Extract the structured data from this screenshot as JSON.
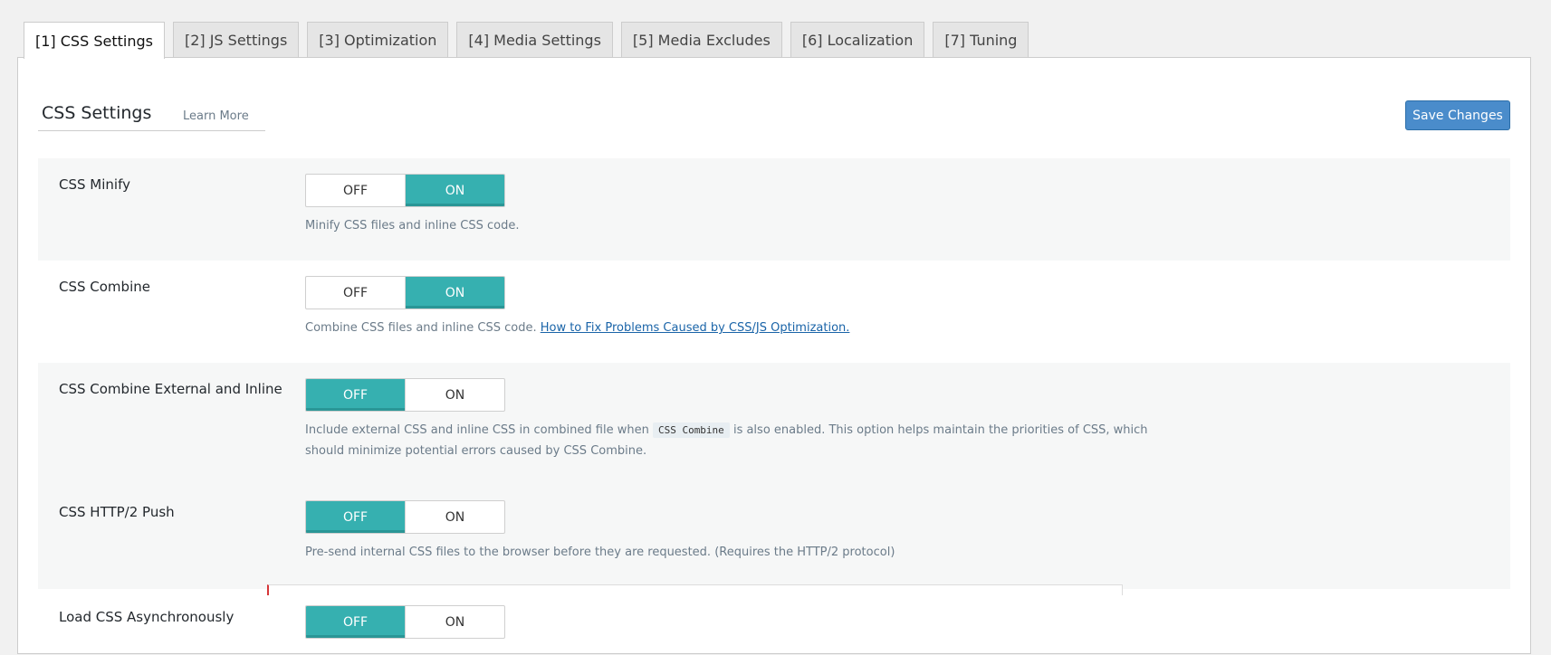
{
  "tabs": [
    {
      "label": "[1] CSS Settings"
    },
    {
      "label": "[2] JS Settings"
    },
    {
      "label": "[3] Optimization"
    },
    {
      "label": "[4] Media Settings"
    },
    {
      "label": "[5] Media Excludes"
    },
    {
      "label": "[6] Localization"
    },
    {
      "label": "[7] Tuning"
    }
  ],
  "active_tab": "[1] CSS Settings",
  "section": {
    "title": "CSS Settings",
    "learn_more": "Learn More",
    "save_label": "Save Changes"
  },
  "toggle_labels": {
    "off": "OFF",
    "on": "ON"
  },
  "settings": [
    {
      "label": "CSS Minify",
      "state": "ON",
      "desc": "Minify CSS files and inline CSS code."
    },
    {
      "label": "CSS Combine",
      "state": "ON",
      "desc": "Combine CSS files and inline CSS code.",
      "link": "How to Fix Problems Caused by CSS/JS Optimization."
    },
    {
      "label": "CSS Combine External and Inline",
      "state": "OFF",
      "desc_pre": "Include external CSS and inline CSS in combined file when",
      "desc_code": "CSS Combine",
      "desc_post": "is also enabled. This option helps maintain the priorities of CSS, which should minimize potential errors caused by CSS Combine."
    },
    {
      "label": "CSS HTTP/2 Push",
      "state": "OFF",
      "desc": "Pre-send internal CSS files to the browser before they are requested. (Requires the HTTP/2 protocol)"
    },
    {
      "label": "Load CSS Asynchronously",
      "state": "OFF"
    }
  ],
  "colors": {
    "accent_teal": "#36b0b0",
    "primary_button": "#4a8ccb",
    "link": "#1a64a8"
  }
}
